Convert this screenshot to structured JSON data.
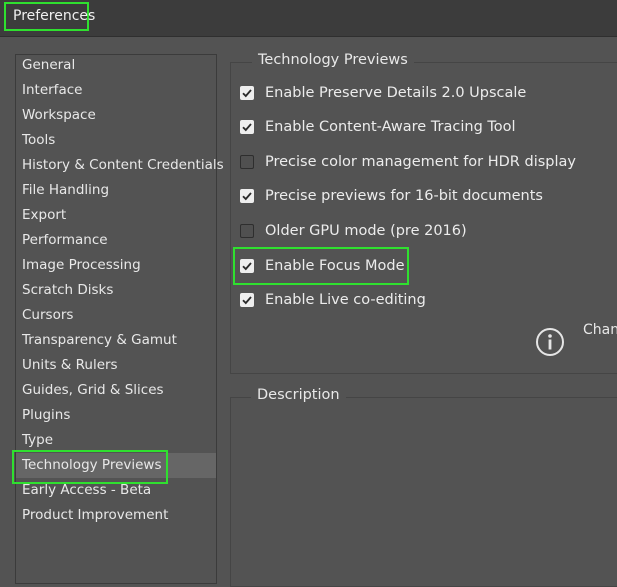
{
  "window": {
    "title": "Preferences"
  },
  "sidebar": {
    "items": [
      {
        "label": "General"
      },
      {
        "label": "Interface"
      },
      {
        "label": "Workspace"
      },
      {
        "label": "Tools"
      },
      {
        "label": "History & Content Credentials"
      },
      {
        "label": "File Handling"
      },
      {
        "label": "Export"
      },
      {
        "label": "Performance"
      },
      {
        "label": "Image Processing"
      },
      {
        "label": "Scratch Disks"
      },
      {
        "label": "Cursors"
      },
      {
        "label": "Transparency & Gamut"
      },
      {
        "label": "Units & Rulers"
      },
      {
        "label": "Guides, Grid & Slices"
      },
      {
        "label": "Plugins"
      },
      {
        "label": "Type"
      },
      {
        "label": "Technology Previews",
        "selected": true
      },
      {
        "label": "Early Access - Beta"
      },
      {
        "label": "Product Improvement"
      }
    ]
  },
  "tech_previews": {
    "title": "Technology Previews",
    "options": [
      {
        "label": "Enable Preserve Details 2.0 Upscale",
        "checked": true
      },
      {
        "label": "Enable Content-Aware Tracing Tool",
        "checked": true
      },
      {
        "label": "Precise color management for HDR display",
        "checked": false
      },
      {
        "label": "Precise previews for 16-bit documents",
        "checked": true
      },
      {
        "label": "Older GPU mode (pre 2016)",
        "checked": false
      },
      {
        "label": "Enable Focus Mode",
        "checked": true
      },
      {
        "label": "Enable Live co-editing",
        "checked": true
      }
    ],
    "info_icon": "info-circle-icon",
    "info_text": "Chan"
  },
  "description": {
    "title": "Description"
  },
  "colors": {
    "highlight": "#2fe02f",
    "background": "#535353",
    "selected": "#666666"
  }
}
